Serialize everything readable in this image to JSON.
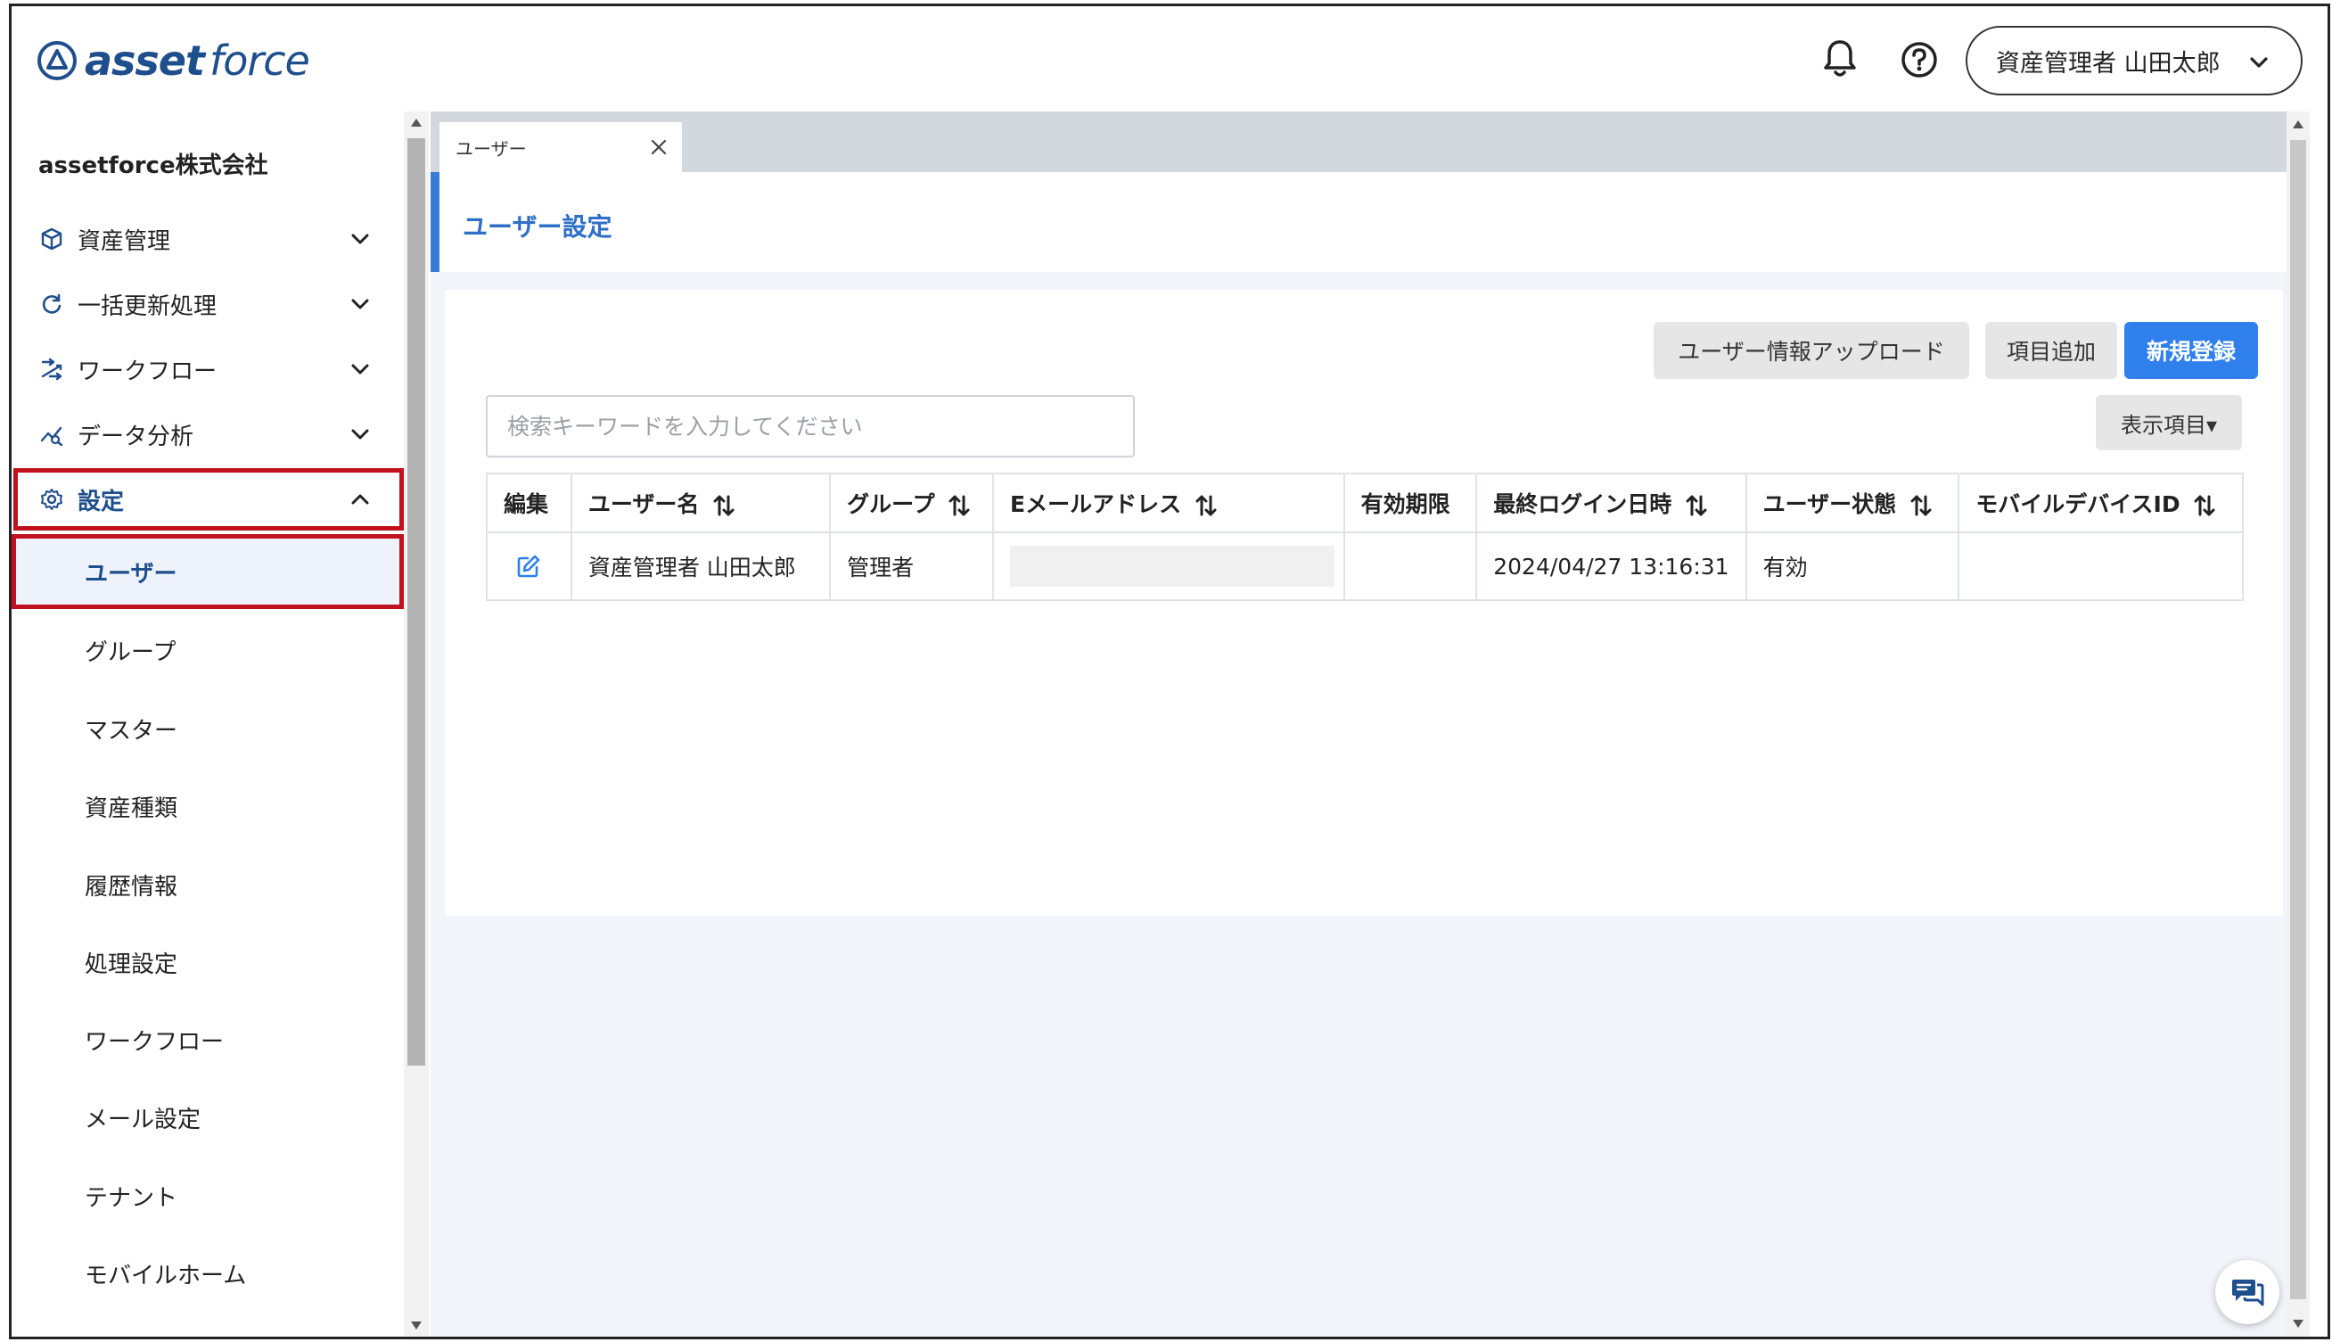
{
  "app": {
    "logo_primary": "asset",
    "logo_secondary": "force"
  },
  "header": {
    "user_label": "資産管理者 山田太郎"
  },
  "sidebar": {
    "company": "assetforce株式会社",
    "nav": [
      {
        "label": "資産管理"
      },
      {
        "label": "一括更新処理"
      },
      {
        "label": "ワークフロー"
      },
      {
        "label": "データ分析"
      },
      {
        "label": "設定"
      }
    ],
    "settings_items": [
      {
        "label": "ユーザー"
      },
      {
        "label": "グループ"
      },
      {
        "label": "マスター"
      },
      {
        "label": "資産種類"
      },
      {
        "label": "履歴情報"
      },
      {
        "label": "処理設定"
      },
      {
        "label": "ワークフロー"
      },
      {
        "label": "メール設定"
      },
      {
        "label": "テナント"
      },
      {
        "label": "モバイルホーム"
      }
    ]
  },
  "tabs": [
    {
      "label": "ユーザー"
    }
  ],
  "page": {
    "title": "ユーザー設定"
  },
  "toolbar": {
    "upload_label": "ユーザー情報アップロード",
    "add_field_label": "項目追加",
    "new_label": "新規登録",
    "display_items_label": "表示項目▾"
  },
  "search": {
    "placeholder": "検索キーワードを入力してください"
  },
  "table": {
    "headers": {
      "edit": "編集",
      "username": "ユーザー名",
      "group": "グループ",
      "email": "Eメールアドレス",
      "expiry": "有効期限",
      "last_login": "最終ログイン日時",
      "status": "ユーザー状態",
      "mobile_id": "モバイルデバイスID"
    },
    "rows": [
      {
        "username": "資産管理者 山田太郎",
        "group": "管理者",
        "email": "",
        "expiry": "",
        "last_login": "2024/04/27 13:16:31",
        "status": "有効",
        "mobile_id": ""
      }
    ]
  },
  "colors": {
    "accent": "#2f80ed",
    "brand": "#1f4e8c",
    "highlight": "#c0121e"
  }
}
